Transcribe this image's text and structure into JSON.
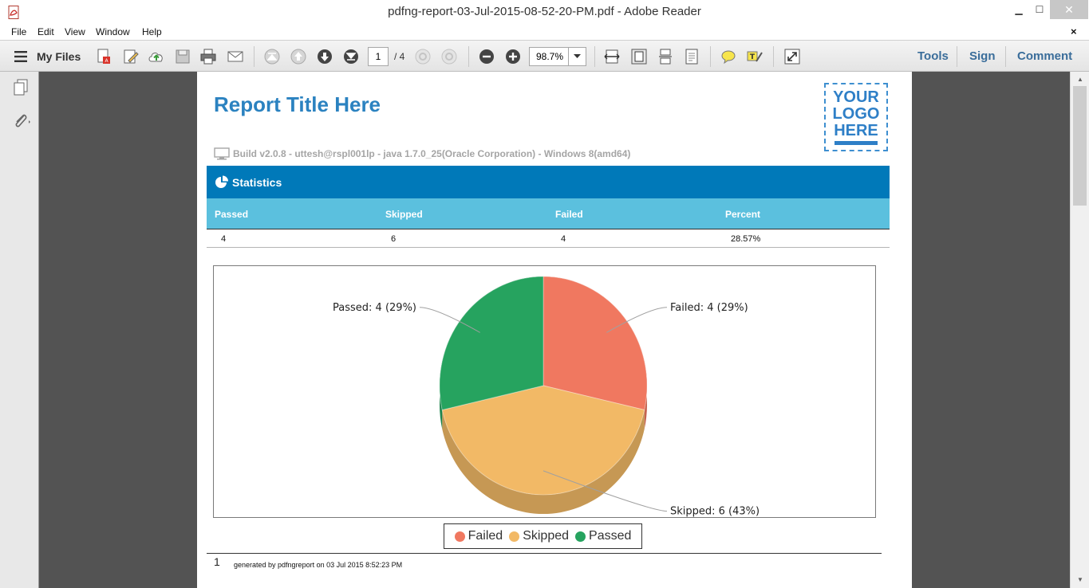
{
  "window": {
    "title": "pdfng-report-03-Jul-2015-08-52-20-PM.pdf - Adobe Reader",
    "minimize": "▁",
    "maximize": "☐",
    "close": "✕"
  },
  "menu": {
    "items": [
      "File",
      "Edit",
      "View",
      "Window",
      "Help"
    ],
    "doc_close": "×"
  },
  "toolbar": {
    "my_files": "My Files",
    "page_current": "1",
    "page_total": "/ 4",
    "zoom": "98.7%",
    "tools": "Tools",
    "sign": "Sign",
    "comment": "Comment"
  },
  "report": {
    "title": "Report Title Here",
    "logo_lines": [
      "YOUR",
      "LOGO",
      "HERE"
    ],
    "build_info": "Build v2.0.8 - uttesh@rspl001lp - java 1.7.0_25(Oracle Corporation) - Windows 8(amd64)",
    "statistics_heading": "Statistics",
    "columns": [
      "Passed",
      "Skipped",
      "Failed",
      "Percent"
    ],
    "row": [
      "4",
      "6",
      "4",
      "28.57%"
    ],
    "footer_page": "1",
    "footer_text": "generated by pdfngreport  on 03 Jul 2015 8:52:23 PM"
  },
  "colors": {
    "failed": "#f07860",
    "skipped": "#f2b966",
    "passed": "#26a35f",
    "header": "#0079b9",
    "subheader": "#5bc0de",
    "title": "#2b82c0"
  },
  "chart_data": {
    "type": "pie",
    "categories": [
      "Failed",
      "Skipped",
      "Passed"
    ],
    "values": [
      4,
      6,
      4
    ],
    "labels": [
      "Failed: 4 (29%)",
      "Skipped: 6 (43%)",
      "Passed: 4 (29%)"
    ],
    "legend": [
      "Failed",
      "Skipped",
      "Passed"
    ],
    "legend_position": "bottom"
  }
}
